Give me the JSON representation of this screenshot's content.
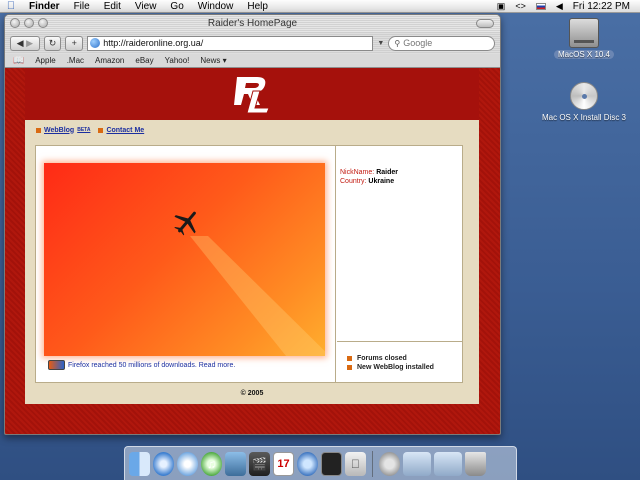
{
  "menubar": {
    "app": "Finder",
    "menus": [
      "File",
      "Edit",
      "View",
      "Go",
      "Window",
      "Help"
    ],
    "clock": "Fri 12:22 PM"
  },
  "window": {
    "title": "Raider's HomePage",
    "url": "http://raideronline.org.ua/",
    "search_placeholder": "Google",
    "bookmarks": [
      "Apple",
      ".Mac",
      "Amazon",
      "eBay",
      "Yahoo!",
      "News ▾"
    ]
  },
  "site": {
    "nav": {
      "weblog": "WebBlog",
      "weblog_sup": "BETA",
      "contact": "Contact Me"
    },
    "news_link": "Firefox reached 50 millions of downloads. Read more.",
    "profile": {
      "nick_label": "NickName:",
      "nick_value": "Raider",
      "country_label": "Country:",
      "country_value": "Ukraine"
    },
    "news": [
      "Forums closed",
      "New WebBlog installed"
    ],
    "footer": "© 2005"
  },
  "desktop": {
    "hd_label": "MacOS X 10.4",
    "disc_label": "Mac OS X Install Disc 3"
  },
  "colors": {
    "site_red": "#a5110c",
    "link_blue": "#1c2fa0",
    "bullet_orange": "#d96a12"
  },
  "dock_icons": [
    "finder-icon",
    "safari-icon",
    "ichat-icon",
    "itunes-icon",
    "iphoto-icon",
    "imovie-icon",
    "ical-icon",
    "quicktime-icon",
    "terminal-icon",
    "preview-icon",
    "system-preferences-icon",
    "window-icon",
    "window-icon",
    "trash-icon"
  ]
}
